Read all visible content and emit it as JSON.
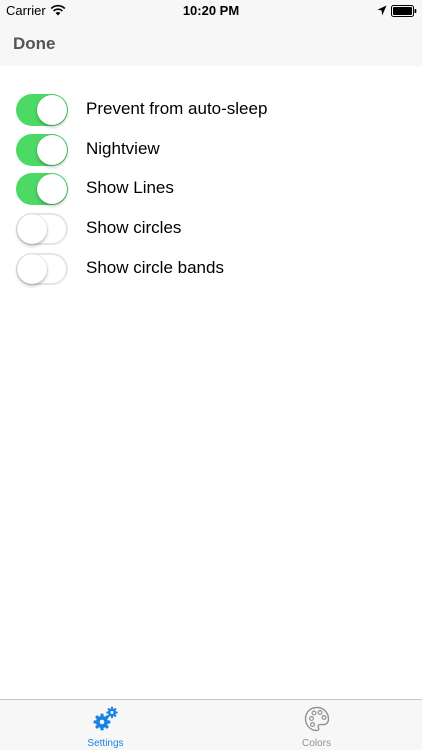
{
  "status_bar": {
    "carrier": "Carrier",
    "time": "10:20 PM",
    "wifi_icon": "wifi-icon",
    "location_icon": "location-arrow-icon",
    "battery_icon": "battery-icon"
  },
  "nav": {
    "done_label": "Done"
  },
  "settings": [
    {
      "label": "Prevent from auto-sleep",
      "enabled": true
    },
    {
      "label": "Nightview",
      "enabled": true
    },
    {
      "label": "Show Lines",
      "enabled": true
    },
    {
      "label": "Show circles",
      "enabled": false
    },
    {
      "label": "Show circle bands",
      "enabled": false
    }
  ],
  "tabs": [
    {
      "label": "Settings",
      "icon": "gears-icon",
      "active": true
    },
    {
      "label": "Colors",
      "icon": "palette-icon",
      "active": false
    }
  ],
  "colors": {
    "switch_on": "#4cd964",
    "active_tab": "#1a82e0",
    "inactive_tab": "#929292"
  }
}
